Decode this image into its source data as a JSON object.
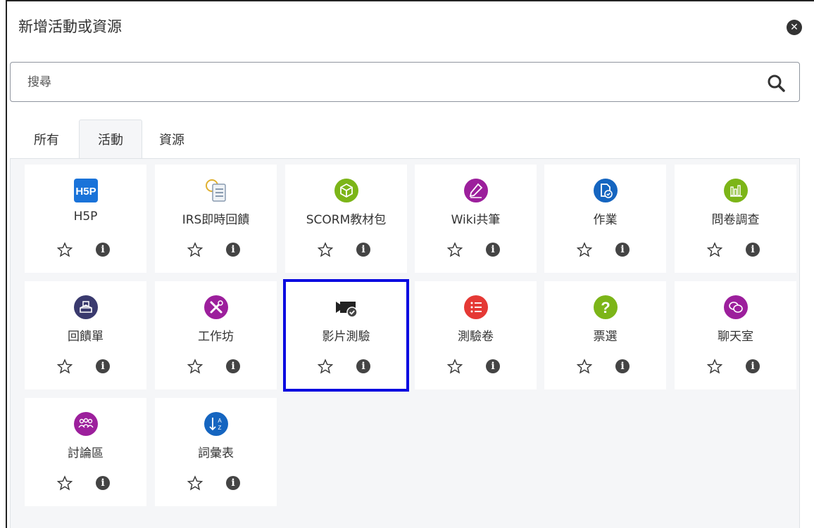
{
  "dialog": {
    "title": "新增活動或資源",
    "close_icon": "close-circle-icon"
  },
  "search": {
    "placeholder": "搜尋",
    "value": ""
  },
  "tabs": [
    {
      "label": "所有",
      "active": false
    },
    {
      "label": "活動",
      "active": true
    },
    {
      "label": "資源",
      "active": false
    }
  ],
  "items": [
    {
      "label": "H5P",
      "icon": "h5p-icon",
      "color": "#1a73d9"
    },
    {
      "label": "IRS即時回饋",
      "icon": "irs-feedback-icon",
      "color": "#8a9bb0"
    },
    {
      "label": "SCORM教材包",
      "icon": "scorm-package-icon",
      "color": "#7cb518"
    },
    {
      "label": "Wiki共筆",
      "icon": "wiki-icon",
      "color": "#9c1f9c"
    },
    {
      "label": "作業",
      "icon": "assignment-icon",
      "color": "#1565c0"
    },
    {
      "label": "問卷調查",
      "icon": "survey-icon",
      "color": "#7cb518"
    },
    {
      "label": "回饋單",
      "icon": "feedback-icon",
      "color": "#3a3a6e"
    },
    {
      "label": "工作坊",
      "icon": "workshop-icon",
      "color": "#9c1f9c"
    },
    {
      "label": "影片測驗",
      "icon": "video-quiz-icon",
      "color": "#222222"
    },
    {
      "label": "測驗卷",
      "icon": "quiz-icon",
      "color": "#e53935"
    },
    {
      "label": "票選",
      "icon": "choice-icon",
      "color": "#7cb518"
    },
    {
      "label": "聊天室",
      "icon": "chat-icon",
      "color": "#9c1f9c"
    },
    {
      "label": "討論區",
      "icon": "forum-icon",
      "color": "#9c1f9c"
    },
    {
      "label": "詞彙表",
      "icon": "glossary-icon",
      "color": "#1565c0"
    }
  ],
  "selected_item": "影片測驗",
  "info_glyph": "i"
}
